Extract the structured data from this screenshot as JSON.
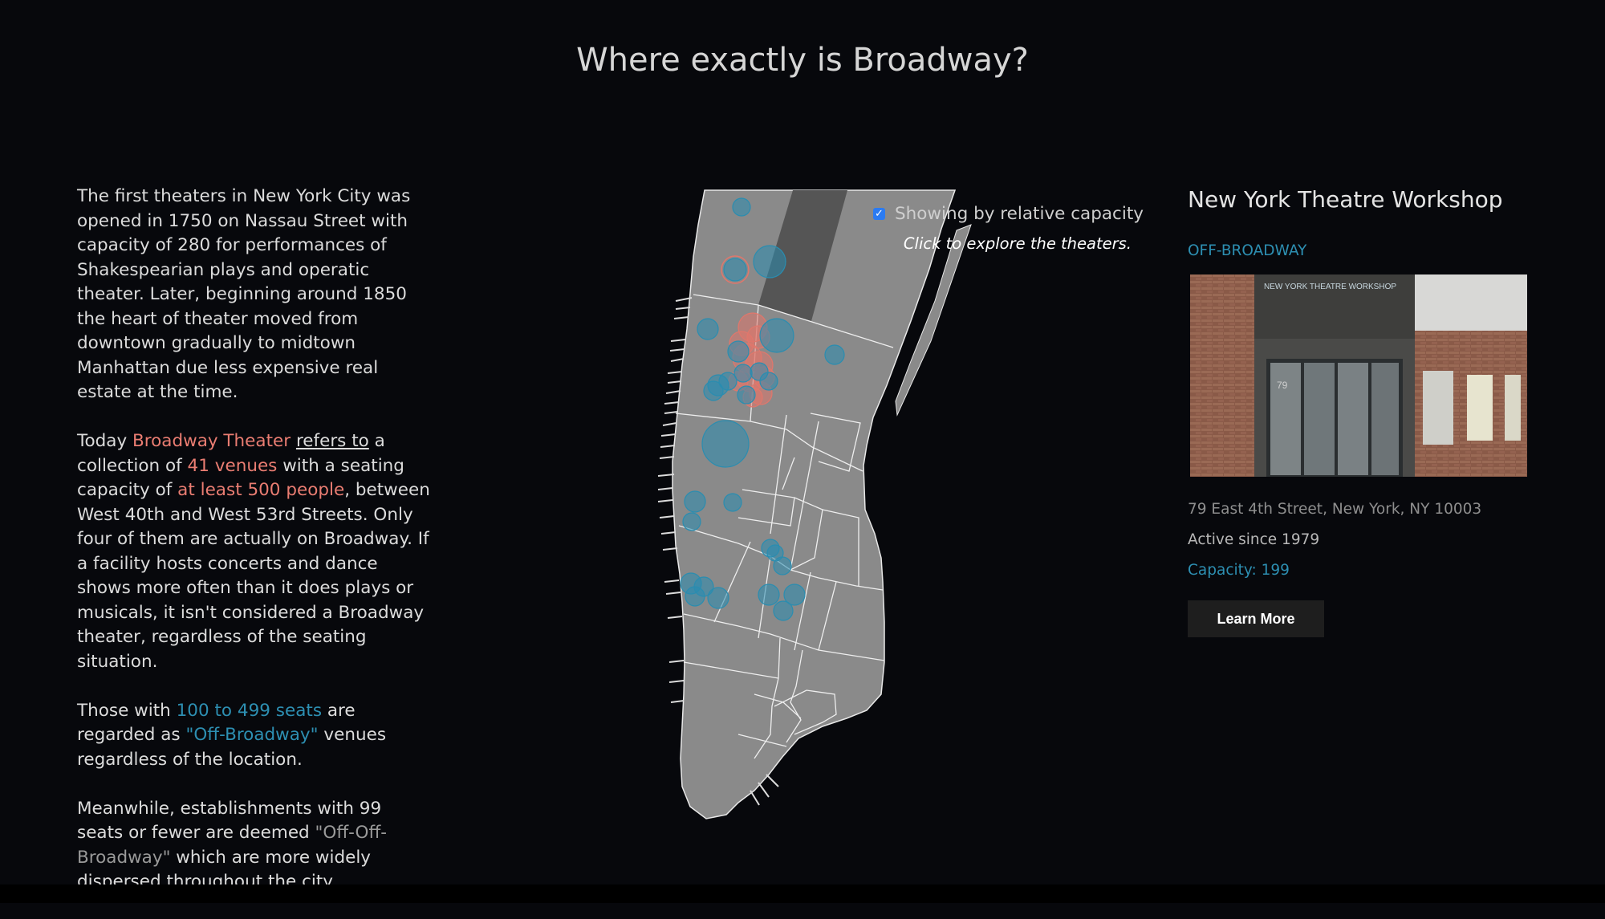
{
  "title": "Where exactly is Broadway?",
  "intro": {
    "p1": "The first theaters in New York City was opened in 1750 on Nassau Street with capacity of 280 for performances of Shakespearian plays and operatic theater. Later, beginning around 1850 the heart of theater moved from downtown gradually to midtown Manhattan due less expensive real estate at the time.",
    "p2": {
      "t1": "Today ",
      "broadway_theater": "Broadway Theater",
      "t2": " ",
      "refers_to": "refers to",
      "t3": " a collection of ",
      "venues": "41 venues",
      "t4": " with a seating capacity of ",
      "capacity": "at least 500 people",
      "t5": ", between West 40th and West 53rd Streets. Only four of them are actually on Broadway. If a facility hosts concerts and dance shows more often than it does plays or musicals, it isn't considered a Broadway theater, regardless of the seating situation."
    },
    "p3": {
      "t1": "Those with ",
      "seats": "100 to 499 seats",
      "t2": " are regarded as ",
      "off_broadway": "\"Off-Broadway\"",
      "t3": " venues regardless of the location."
    },
    "p4": {
      "t1": "Meanwhile, establishments with 99 seats or fewer are deemed ",
      "off_off": "\"Off-Off-Broadway\"",
      "t2": " which are more widely dispersed throughout the city."
    }
  },
  "map": {
    "toggle_label": "Showing by relative capacity",
    "toggle_checked": true,
    "hint": "Click to explore the theaters.",
    "colors": {
      "broadway": "#e0776c",
      "off_broadway": "#2a8db0",
      "land": "#8a8a8a",
      "park": "#555555"
    }
  },
  "detail": {
    "name": "New York Theatre Workshop",
    "type": "OFF-BROADWAY",
    "address": "79 East 4th Street, New York, NY 10003",
    "active": "Active since 1979",
    "capacity": "Capacity: 199",
    "button": "Learn More",
    "photo_sign": "NEW YORK THEATRE WORKSHOP",
    "photo_number": "79"
  }
}
